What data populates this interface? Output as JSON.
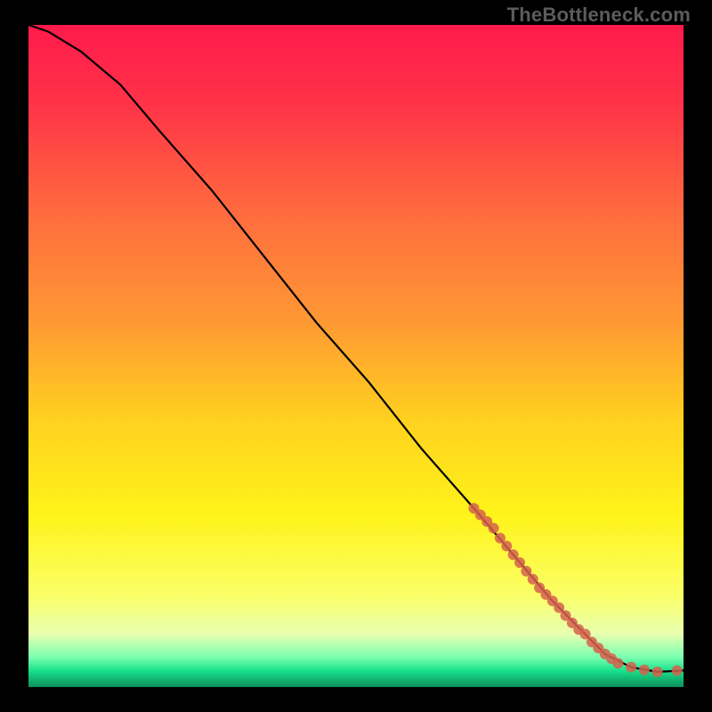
{
  "watermark": "TheBottleneck.com",
  "chart_data": {
    "type": "line",
    "title": "",
    "xlabel": "",
    "ylabel": "",
    "xlim": [
      0,
      100
    ],
    "ylim": [
      0,
      100
    ],
    "grid": false,
    "legend": false,
    "gradient_stops": [
      {
        "offset": 0.0,
        "color": "#ff1a4b"
      },
      {
        "offset": 0.12,
        "color": "#ff3348"
      },
      {
        "offset": 0.28,
        "color": "#ff6a3f"
      },
      {
        "offset": 0.45,
        "color": "#ff9933"
      },
      {
        "offset": 0.6,
        "color": "#ffd21f"
      },
      {
        "offset": 0.74,
        "color": "#fff31a"
      },
      {
        "offset": 0.86,
        "color": "#fbff66"
      },
      {
        "offset": 0.92,
        "color": "#e8ffb0"
      },
      {
        "offset": 0.955,
        "color": "#7affb0"
      },
      {
        "offset": 0.975,
        "color": "#19e28c"
      },
      {
        "offset": 1.0,
        "color": "#0b8f5a"
      }
    ],
    "series": [
      {
        "name": "curve",
        "kind": "line",
        "color": "#000000",
        "x": [
          0,
          3,
          8,
          14,
          20,
          28,
          36,
          44,
          52,
          60,
          68,
          74,
          80,
          85,
          88,
          92,
          96,
          100
        ],
        "y": [
          100,
          99,
          96,
          91,
          84,
          75,
          65,
          55,
          46,
          36,
          27,
          20,
          13,
          8,
          5,
          3,
          2.3,
          2.5
        ]
      },
      {
        "name": "marker-cluster",
        "kind": "scatter",
        "color": "#d6604d",
        "radius": 6,
        "x": [
          68,
          69,
          70,
          71,
          72,
          73,
          74,
          75,
          76,
          77,
          78,
          79,
          80,
          81,
          82,
          83,
          84,
          85,
          86,
          87,
          88,
          89,
          90,
          92,
          94,
          96,
          99
        ],
        "y": [
          27,
          26,
          25,
          24,
          22.5,
          21.3,
          20,
          18.8,
          17.5,
          16.3,
          15,
          14,
          13,
          12,
          10.8,
          9.7,
          8.7,
          8,
          6.8,
          5.9,
          5,
          4.3,
          3.6,
          3,
          2.6,
          2.3,
          2.5
        ]
      }
    ]
  }
}
